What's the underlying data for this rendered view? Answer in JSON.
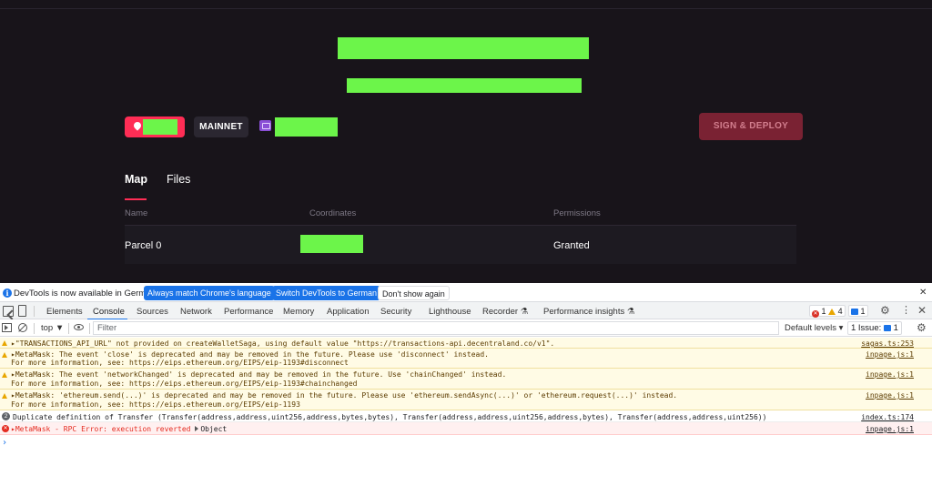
{
  "app": {
    "network_label": "MAINNET",
    "deploy_label": "SIGN & DEPLOY",
    "tabs": [
      {
        "label": "Map"
      },
      {
        "label": "Files"
      }
    ],
    "table": {
      "headers": [
        "Name",
        "Coordinates",
        "Permissions"
      ],
      "rows": [
        {
          "name": "Parcel 0",
          "permissions": "Granted"
        }
      ]
    },
    "colors": {
      "accent": "#ff2d55",
      "background": "#18141a",
      "redaction": "#6cf54a"
    }
  },
  "devtools": {
    "infobar": {
      "text": "DevTools is now available in German!",
      "match_button": "Always match Chrome's language",
      "switch_button": "Switch DevTools to German",
      "dismiss_button": "Don't show again"
    },
    "tabs": [
      "Elements",
      "Console",
      "Sources",
      "Network",
      "Performance",
      "Memory",
      "Application",
      "Security",
      "Lighthouse",
      "Recorder",
      "Performance insights"
    ],
    "active_tab": "Console",
    "counts": {
      "errors": "1",
      "warnings": "4",
      "messages": "1"
    },
    "filter": {
      "context": "top ▼",
      "placeholder": "Filter",
      "levels": "Default levels ▾",
      "issues_label": "1 Issue:",
      "issues_count": "1"
    },
    "console": [
      {
        "level": "warn",
        "lines": [
          "▸\"TRANSACTIONS_API_URL\" not provided on createWalletSaga, using default value \"https://transactions-api.decentraland.co/v1\"."
        ],
        "source": "sagas.ts:253"
      },
      {
        "level": "warn",
        "lines": [
          "▸MetaMask: The event 'close' is deprecated and may be removed in the future. Please use 'disconnect' instead.",
          "For more information, see: https://eips.ethereum.org/EIPS/eip-1193#disconnect"
        ],
        "source": "inpage.js:1"
      },
      {
        "level": "warn",
        "lines": [
          "▸MetaMask: The event 'networkChanged' is deprecated and may be removed in the future. Use 'chainChanged' instead.",
          "For more information, see: https://eips.ethereum.org/EIPS/eip-1193#chainchanged"
        ],
        "source": "inpage.js:1"
      },
      {
        "level": "warn",
        "lines": [
          "▸MetaMask: 'ethereum.send(...)' is deprecated and may be removed in the future. Please use 'ethereum.sendAsync(...)' or 'ethereum.request(...)' instead.",
          "For more information, see: https://eips.ethereum.org/EIPS/eip-1193"
        ],
        "source": "inpage.js:1"
      },
      {
        "level": "info",
        "count": "2",
        "lines": [
          "Duplicate definition of Transfer (Transfer(address,address,uint256,address,bytes,bytes), Transfer(address,address,uint256,address,bytes), Transfer(address,address,uint256))"
        ],
        "source": "index.ts:174"
      },
      {
        "level": "error",
        "lines": [
          "▸MetaMask - RPC Error: execution reverted"
        ],
        "object_label": "Object",
        "source": "inpage.js:1"
      }
    ],
    "prompt": "›"
  }
}
